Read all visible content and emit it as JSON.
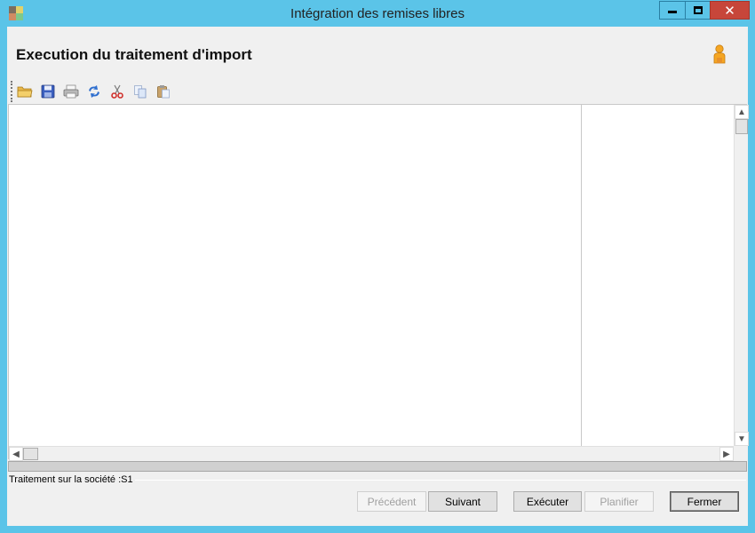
{
  "window": {
    "title": "Intégration des remises libres",
    "controls": {
      "minimize": "minimize",
      "maximize": "maximize",
      "close": "✕"
    }
  },
  "header": {
    "title": "Execution du traitement d'import",
    "user_icon": "user-icon"
  },
  "toolbar": {
    "buttons": [
      {
        "name": "open-folder-icon",
        "label": "Ouvrir"
      },
      {
        "name": "save-icon",
        "label": "Enregistrer"
      },
      {
        "name": "print-icon",
        "label": "Imprimer"
      },
      {
        "name": "refresh-icon",
        "label": "Actualiser"
      },
      {
        "name": "cut-icon",
        "label": "Couper"
      },
      {
        "name": "copy-icon",
        "label": "Copier"
      },
      {
        "name": "paste-icon",
        "label": "Coller"
      }
    ]
  },
  "scrollbars": {
    "up": "▲",
    "down": "▼",
    "left": "◀",
    "right": "▶"
  },
  "status": {
    "text": "Traitement sur la société :S1"
  },
  "buttons": {
    "previous": "Précédent",
    "next": "Suivant",
    "execute": "Exécuter",
    "schedule": "Planifier",
    "close": "Fermer"
  },
  "colors": {
    "titlebar": "#5bc4e8",
    "close_button": "#c7463a",
    "client_bg": "#f0f0f0",
    "pane_bg": "#ffffff"
  }
}
